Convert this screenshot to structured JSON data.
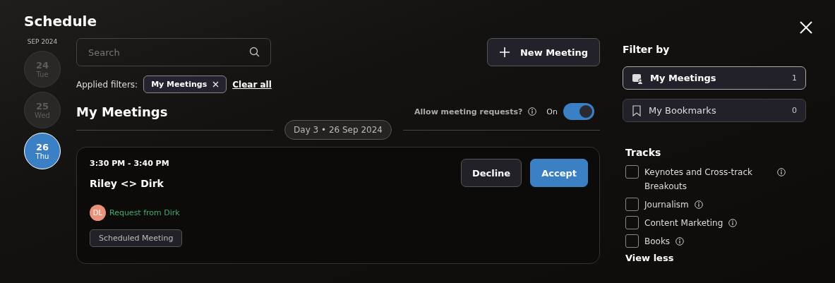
{
  "title": "Schedule",
  "dates": {
    "month": "SEP 2024",
    "days": [
      {
        "day": "24",
        "weekday": "Tue",
        "selected": false
      },
      {
        "day": "25",
        "weekday": "Wed",
        "selected": false
      },
      {
        "day": "26",
        "weekday": "Thu",
        "selected": true
      }
    ]
  },
  "search": {
    "placeholder": "Search"
  },
  "new_meeting": "New Meeting",
  "applied_filters": {
    "label": "Applied filters:",
    "chips": [
      "My Meetings"
    ],
    "clear": "Clear all"
  },
  "section_title": "My Meetings",
  "allow_requests": {
    "label": "Allow meeting requests?",
    "state_text": "On",
    "on": true
  },
  "day_divider": "Day 3 • 26 Sep 2024",
  "meetings": [
    {
      "time": "3:30 PM - 3:40 PM",
      "title": "Riley <> Dirk",
      "initials": "DL",
      "request": "Request from Dirk",
      "tag": "Scheduled Meeting",
      "actions": [
        {
          "label": "Decline",
          "kind": "secondary"
        },
        {
          "label": "Accept",
          "kind": "primary"
        }
      ]
    }
  ],
  "filter_by": {
    "title": "Filter by",
    "items": [
      {
        "kind": "meetings",
        "label": "My Meetings",
        "count": "1",
        "selected": true
      },
      {
        "kind": "bookmarks",
        "label": "My Bookmarks",
        "count": "0",
        "selected": false
      }
    ]
  },
  "tracks": {
    "title": "Tracks",
    "items": [
      {
        "label": "Keynotes and Cross-track Breakouts",
        "checked": false
      },
      {
        "label": "Journalism",
        "checked": false
      },
      {
        "label": "Content Marketing",
        "checked": false
      },
      {
        "label": "Books",
        "checked": false
      }
    ],
    "toggle": "View less"
  }
}
